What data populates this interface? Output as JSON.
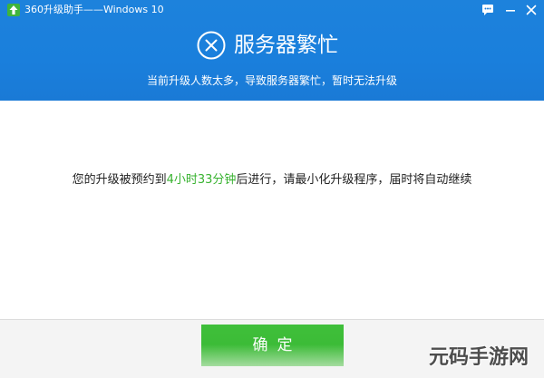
{
  "window": {
    "title": "360升级助手——Windows 10",
    "icons": {
      "app": "upgrade-arrow-icon",
      "feedback": "chat-bubble-icon",
      "minimize": "minimize-icon",
      "close": "close-icon"
    }
  },
  "header": {
    "status_icon": "circle-x-icon",
    "title": "服务器繁忙",
    "subtitle": "当前升级人数太多，导致服务器繁忙，暂时无法升级"
  },
  "main": {
    "message_prefix": "您的升级被预约到",
    "message_time": "4小时33分钟",
    "message_suffix": "后进行，请最小化升级程序，届时将自动继续"
  },
  "footer": {
    "confirm_label": "确定"
  },
  "watermark": {
    "text": "元码手游网"
  },
  "colors": {
    "header_blue": "#1a7fdc",
    "confirm_green": "#3bba35",
    "highlight_green": "#37b22f"
  }
}
